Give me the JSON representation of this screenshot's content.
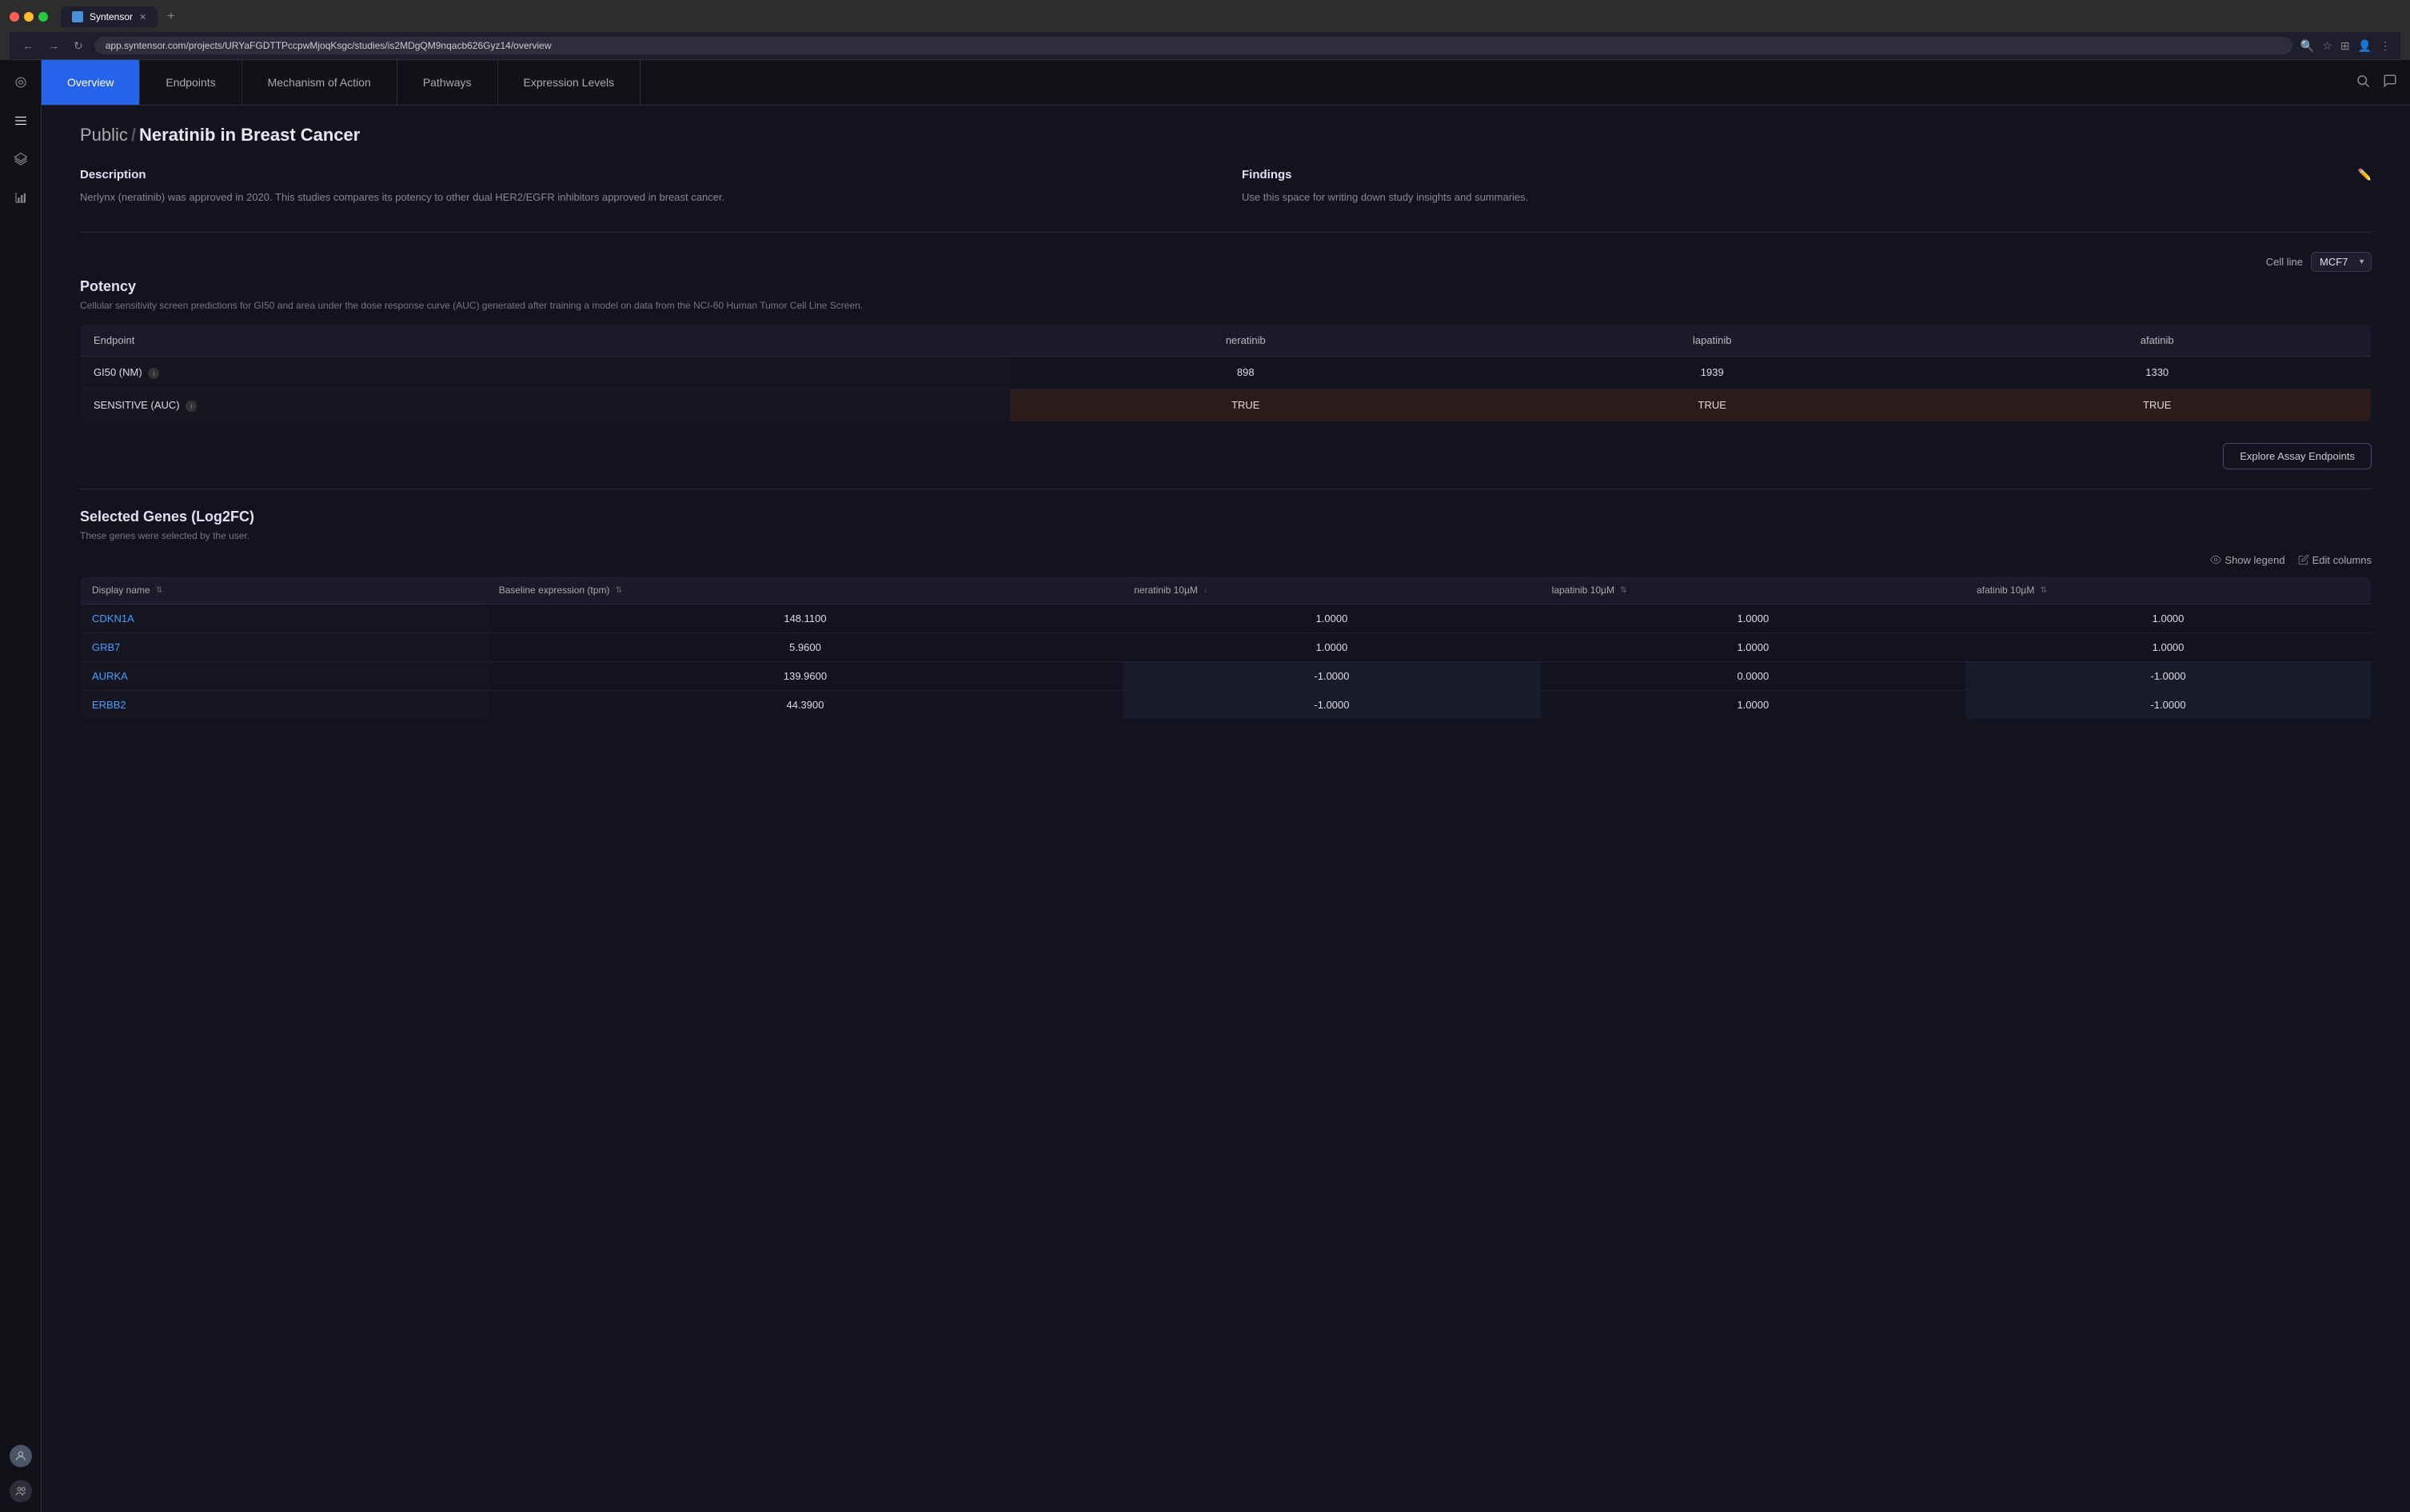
{
  "browser": {
    "tab_title": "Syntensor",
    "url": "app.syntensor.com/projects/URYaFGDTTPccpwMjoqKsgc/studies/is2MDgQM9nqacb626Gyz14/overview"
  },
  "nav": {
    "items": [
      "Overview",
      "Endpoints",
      "Mechanism of Action",
      "Pathways",
      "Expression Levels"
    ],
    "active_item": "Overview",
    "search_label": "search",
    "chat_label": "chat"
  },
  "page": {
    "breadcrumb_public": "Public",
    "breadcrumb_sep": "/",
    "study_name": "Neratinib in Breast Cancer",
    "description_label": "Description",
    "description_text": "Nerlynx (neratinib) was approved in 2020. This studies compares its potency to other dual HER2/EGFR inhibitors approved in breast cancer.",
    "findings_label": "Findings",
    "findings_text": "Use this space for writing down study insights and summaries.",
    "potency_title": "Potency",
    "potency_subtitle": "Cellular sensitivity screen predictions for GI50 and area under the dose response curve (AUC) generated after training a model on data from the NCI-60 Human Tumor Cell Line Screen.",
    "cell_line_label": "Cell line",
    "cell_line_value": "MCF7",
    "endpoint_col": "Endpoint",
    "drugs": [
      "neratinib",
      "lapatinib",
      "afatinib"
    ],
    "potency_rows": [
      {
        "name": "GI50 (NM)",
        "info": true,
        "values": [
          "898",
          "1939",
          "1330"
        ],
        "type": "number"
      },
      {
        "name": "SENSITIVE (AUC)",
        "info": true,
        "values": [
          "TRUE",
          "TRUE",
          "TRUE"
        ],
        "type": "sensitive"
      }
    ],
    "explore_btn_label": "Explore Assay Endpoints",
    "genes_title": "Selected Genes (Log2FC)",
    "genes_subtitle": "These genes were selected by the user.",
    "show_legend_label": "Show legend",
    "edit_columns_label": "Edit columns",
    "genes_cols": {
      "display_name": "Display name",
      "baseline": "Baseline expression (tpm)",
      "neratinib": "neratinib 10µM",
      "lapatinib": "lapatinib 10µM",
      "afatinib": "afatinib 10µM"
    },
    "genes_rows": [
      {
        "name": "CDKN1A",
        "baseline": "148.1100",
        "neratinib": "1.0000",
        "lapatinib": "1.0000",
        "afatinib": "1.0000",
        "neratinib_type": "neutral",
        "lapatinib_type": "neutral",
        "afatinib_type": "neutral"
      },
      {
        "name": "GRB7",
        "baseline": "5.9600",
        "neratinib": "1.0000",
        "lapatinib": "1.0000",
        "afatinib": "1.0000",
        "neratinib_type": "neutral",
        "lapatinib_type": "neutral",
        "afatinib_type": "neutral"
      },
      {
        "name": "AURKA",
        "baseline": "139.9600",
        "neratinib": "-1.0000",
        "lapatinib": "0.0000",
        "afatinib": "-1.0000",
        "neratinib_type": "negative",
        "lapatinib_type": "neutral",
        "afatinib_type": "negative"
      },
      {
        "name": "ERBB2",
        "baseline": "44.3900",
        "neratinib": "-1.0000",
        "lapatinib": "1.0000",
        "afatinib": "-1.0000",
        "neratinib_type": "negative",
        "lapatinib_type": "neutral",
        "afatinib_type": "negative"
      }
    ]
  }
}
